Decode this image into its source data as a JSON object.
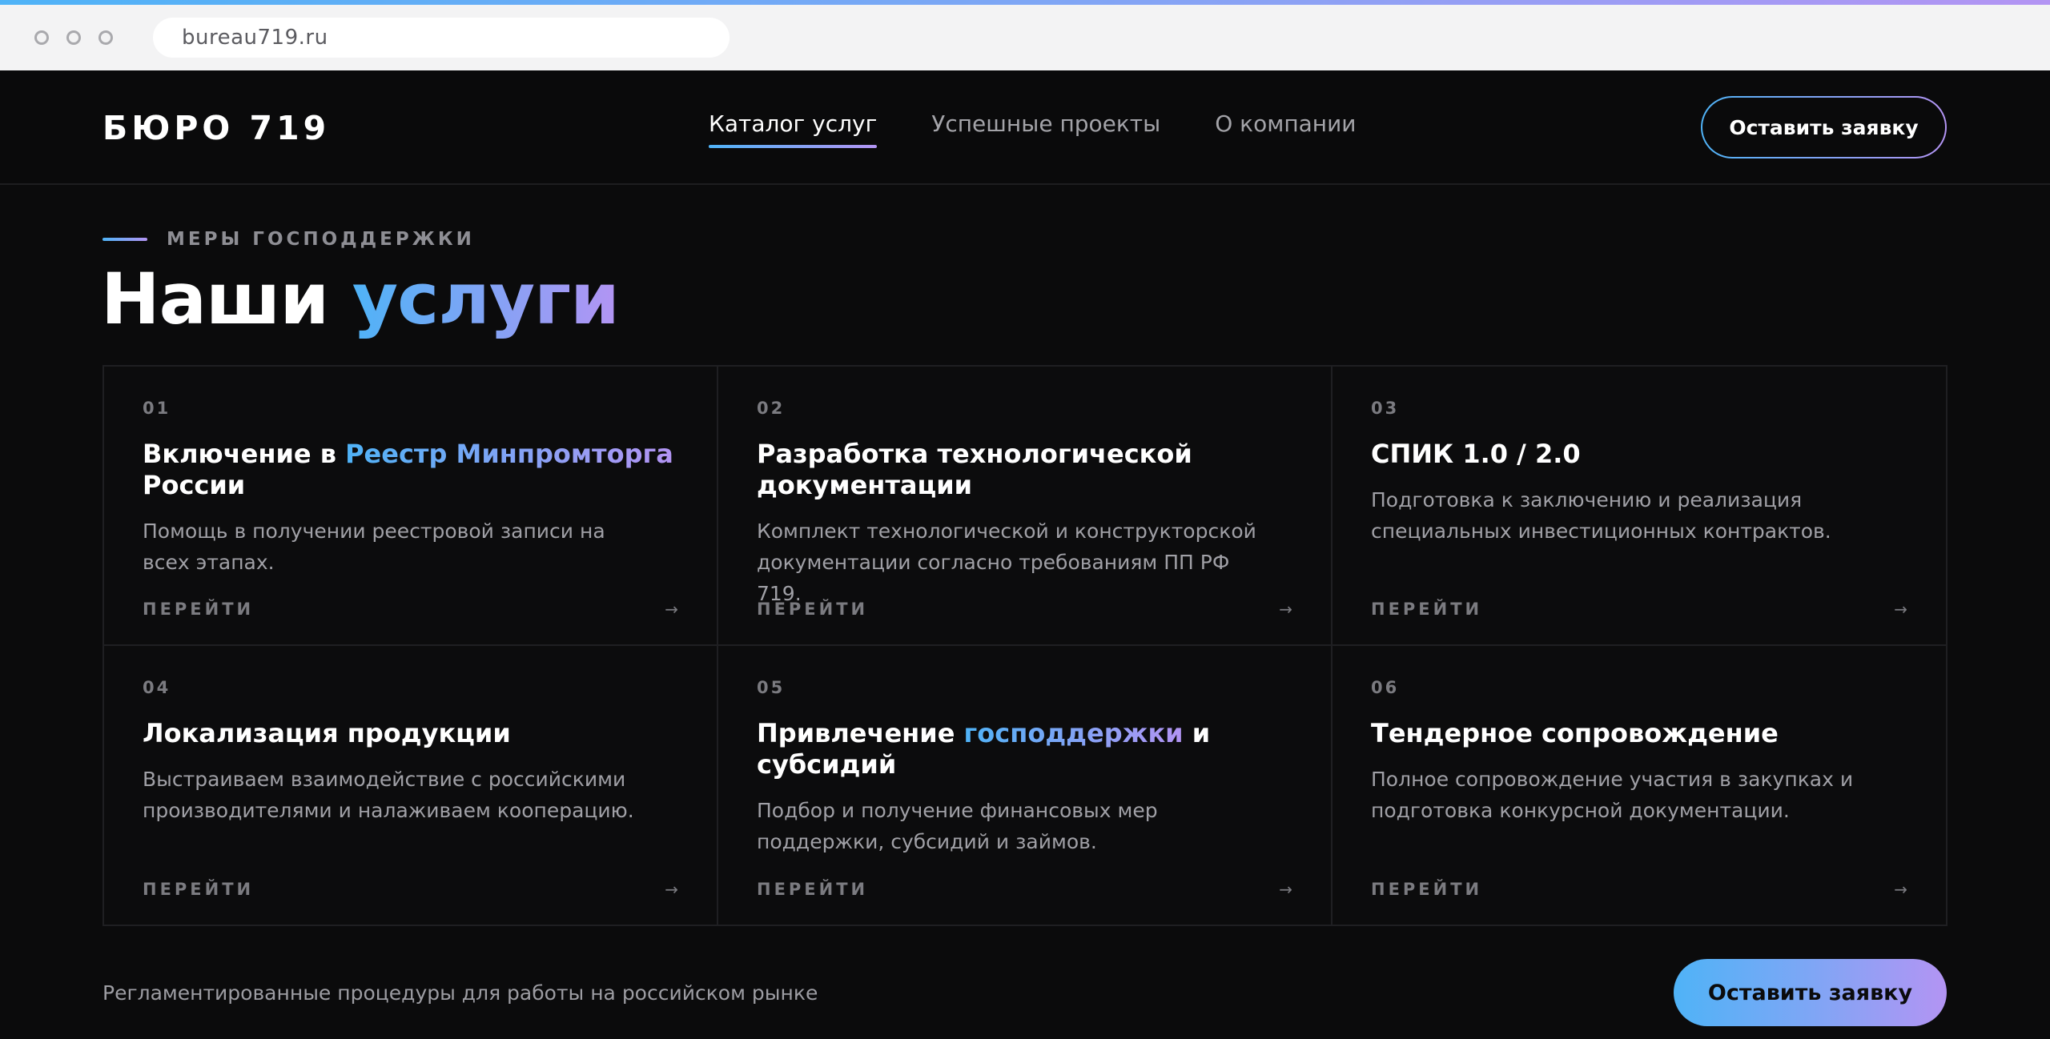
{
  "browser": {
    "url": "bureau719.ru"
  },
  "header": {
    "logo": "БЮРО 719",
    "nav": [
      {
        "label": "Каталог услуг",
        "active": true
      },
      {
        "label": "Успешные проекты",
        "active": false
      },
      {
        "label": "О компании",
        "active": false
      }
    ],
    "cta_label": "Оставить заявку"
  },
  "section": {
    "eyebrow": "МЕРЫ ГОСПОДДЕРЖКИ",
    "title_plain": "Наши",
    "title_accent": "услуги"
  },
  "services": [
    {
      "num": "01",
      "title_pre": "Включение в ",
      "title_accent": "Реестр Минпромторга",
      "title_post": " России",
      "desc": "Помощь в получении реестровой записи на всех этапах.",
      "link": "ПЕРЕЙТИ",
      "arrow": "→"
    },
    {
      "num": "02",
      "title_pre": "Разработка технологической документации",
      "title_accent": "",
      "title_post": "",
      "desc": "Комплект технологической и конструкторской документации согласно требованиям ПП РФ 719.",
      "link": "ПЕРЕЙТИ",
      "arrow": "→"
    },
    {
      "num": "03",
      "title_pre": "СПИК 1.0 / 2.0",
      "title_accent": "",
      "title_post": "",
      "desc": "Подготовка к заключению и реализация специальных инвестиционных контрактов.",
      "link": "ПЕРЕЙТИ",
      "arrow": "→"
    },
    {
      "num": "04",
      "title_pre": "Локализация продукции",
      "title_accent": "",
      "title_post": "",
      "desc": "Выстраиваем взаимодействие с российскими производителями и налаживаем кооперацию.",
      "link": "ПЕРЕЙТИ",
      "arrow": "→"
    },
    {
      "num": "05",
      "title_pre": "Привлечение ",
      "title_accent": "господдержки",
      "title_post": " и субсидий",
      "desc": "Подбор и получение финансовых мер поддержки, субсидий и займов.",
      "link": "ПЕРЕЙТИ",
      "arrow": "→"
    },
    {
      "num": "06",
      "title_pre": "Тендерное сопровождение",
      "title_accent": "",
      "title_post": "",
      "desc": "Полное сопровождение участия в закупках и подготовка конкурсной документации.",
      "link": "ПЕРЕЙТИ",
      "arrow": "→"
    }
  ],
  "footer": {
    "note": "Регламентированные процедуры для работы на российском рынке",
    "cta_label": "Оставить заявку"
  },
  "colors": {
    "background": "#0b0b0c",
    "accent_start": "#4fb3f7",
    "accent_end": "#b394f3",
    "muted_text": "#a0a0a6"
  }
}
